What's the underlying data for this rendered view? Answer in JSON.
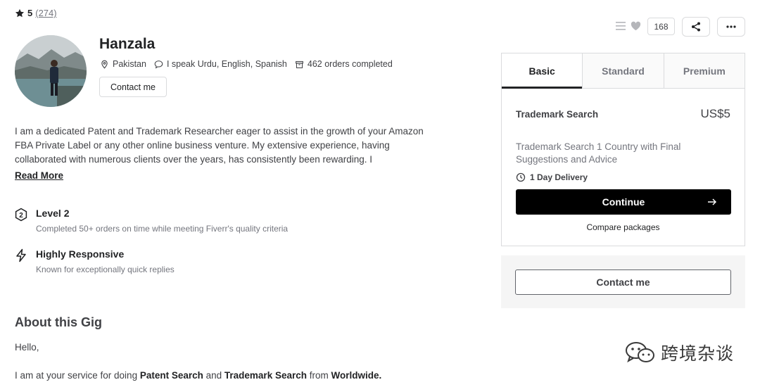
{
  "rating": {
    "score": "5",
    "count": "(274)"
  },
  "seller": {
    "name": "Hanzala",
    "location": "Pakistan",
    "languages": "I speak Urdu, English, Spanish",
    "orders": "462 orders completed",
    "contact_label": "Contact me"
  },
  "description": "I am a dedicated Patent and Trademark Researcher eager to assist in the growth of your Amazon FBA Private Label or any other online business venture. My extensive experience, having collaborated with numerous clients over the years, has consistently been rewarding. I",
  "read_more": "Read More",
  "badges": [
    {
      "title": "Level 2",
      "subtitle": "Completed 50+ orders on time while meeting Fiverr's quality criteria",
      "icon": "level-badge-icon"
    },
    {
      "title": "Highly Responsive",
      "subtitle": "Known for exceptionally quick replies",
      "icon": "lightning-icon"
    }
  ],
  "about": {
    "title": "About this Gig",
    "hello": "Hello,",
    "service": {
      "prefix": "I am at your service for doing ",
      "bold1": "Patent Search",
      "mid": " and ",
      "bold2": "Trademark Search",
      "mid2": " from ",
      "bold3": "Worldwide."
    }
  },
  "actions": {
    "like_count": "168"
  },
  "package": {
    "tabs": [
      "Basic",
      "Standard",
      "Premium"
    ],
    "active_tab": "Basic",
    "title": "Trademark Search",
    "price": "US$5",
    "description": "Trademark Search 1 Country with Final Suggestions and Advice",
    "delivery": "1 Day Delivery",
    "continue_label": "Continue",
    "compare_label": "Compare packages"
  },
  "contact_panel": {
    "label": "Contact me"
  },
  "watermark": {
    "text": "跨境杂谈"
  },
  "colors": {
    "accent": "#000000",
    "text": "#404145",
    "muted": "#74767e",
    "border": "#dadbdd"
  }
}
